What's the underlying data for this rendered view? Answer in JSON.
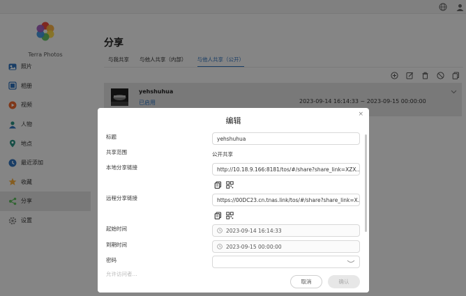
{
  "topbar": {
    "icons": [
      "globe-icon",
      "user-icon"
    ]
  },
  "app": {
    "name": "Terra Photos"
  },
  "sidebar": {
    "items": [
      {
        "label": "照片",
        "icon": "photo-icon"
      },
      {
        "label": "相册",
        "icon": "album-icon"
      },
      {
        "label": "视频",
        "icon": "video-icon"
      },
      {
        "label": "人物",
        "icon": "person-icon"
      },
      {
        "label": "地点",
        "icon": "location-icon"
      },
      {
        "label": "最近添加",
        "icon": "recent-icon"
      },
      {
        "label": "收藏",
        "icon": "star-icon"
      },
      {
        "label": "分享",
        "icon": "share-icon",
        "active": true
      },
      {
        "label": "设置",
        "icon": "settings-icon"
      }
    ]
  },
  "main": {
    "title": "分享",
    "tabs": [
      {
        "label": "与我共享"
      },
      {
        "label": "与他人共享（内部）"
      },
      {
        "label": "与他人共享（公开）",
        "active": true
      }
    ],
    "toolbar": [
      "add-icon",
      "edit-icon",
      "delete-icon",
      "disable-icon",
      "copy-icon"
    ],
    "share": {
      "name": "yehshuhua",
      "status": "已启用",
      "time_range": "2023-09-14 16:14:33 ~ 2023-09-15 00:00:00"
    }
  },
  "dialog": {
    "title": "编辑",
    "close": "×",
    "labels": {
      "title": "标题",
      "scope": "共享范围",
      "local_link": "本地分享链接",
      "remote_link": "远程分享链接",
      "start_time": "起始时间",
      "end_time": "到期时间",
      "password": "密码",
      "faded": "允许访问者..."
    },
    "values": {
      "title": "yehshuhua",
      "scope": "公开共享",
      "local_link": "http://10.18.9.166:8181/tos/#/share?share_link=XZX...",
      "remote_link": "https://00DC23.cn.tnas.link/tos/#/share?share_link=X...",
      "start_time": "2023-09-14 16:14:33",
      "end_time": "2023-09-15 00:00:00",
      "password": ""
    },
    "buttons": {
      "cancel": "取消",
      "ok": "确认"
    }
  },
  "colors": {
    "accent": "#2f6fb8",
    "overlay": "rgba(0,0,0,0.45)"
  }
}
